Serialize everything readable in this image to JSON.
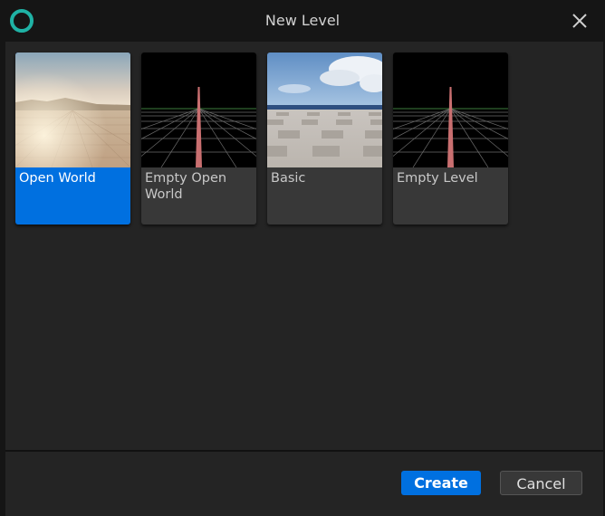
{
  "window": {
    "title": "New Level",
    "logo_icon": "app-logo-ring-icon",
    "close_icon": "close-icon"
  },
  "templates": [
    {
      "label": "Open World",
      "selected": true,
      "thumbnail": "desert-sky-thumbnail"
    },
    {
      "label": "Empty Open World",
      "selected": false,
      "thumbnail": "grid-horizon-thumbnail"
    },
    {
      "label": "Basic",
      "selected": false,
      "thumbnail": "checker-floor-sky-thumbnail"
    },
    {
      "label": "Empty Level",
      "selected": false,
      "thumbnail": "grid-horizon-thumbnail"
    }
  ],
  "footer": {
    "create_label": "Create",
    "cancel_label": "Cancel"
  },
  "colors": {
    "accent": "#0070e0",
    "logo": "#1fb2a5",
    "background": "#242424",
    "tile": "#383838"
  }
}
